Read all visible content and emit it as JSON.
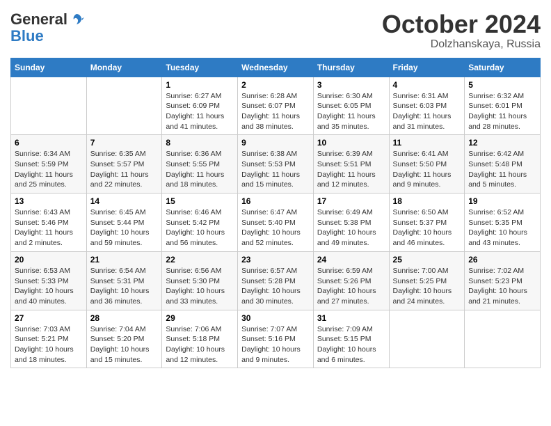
{
  "logo": {
    "general": "General",
    "blue": "Blue",
    "icon": "▶"
  },
  "title": "October 2024",
  "subtitle": "Dolzhanskaya, Russia",
  "days_of_week": [
    "Sunday",
    "Monday",
    "Tuesday",
    "Wednesday",
    "Thursday",
    "Friday",
    "Saturday"
  ],
  "weeks": [
    [
      {
        "num": "",
        "info": ""
      },
      {
        "num": "",
        "info": ""
      },
      {
        "num": "1",
        "info": "Sunrise: 6:27 AM\nSunset: 6:09 PM\nDaylight: 11 hours and 41 minutes."
      },
      {
        "num": "2",
        "info": "Sunrise: 6:28 AM\nSunset: 6:07 PM\nDaylight: 11 hours and 38 minutes."
      },
      {
        "num": "3",
        "info": "Sunrise: 6:30 AM\nSunset: 6:05 PM\nDaylight: 11 hours and 35 minutes."
      },
      {
        "num": "4",
        "info": "Sunrise: 6:31 AM\nSunset: 6:03 PM\nDaylight: 11 hours and 31 minutes."
      },
      {
        "num": "5",
        "info": "Sunrise: 6:32 AM\nSunset: 6:01 PM\nDaylight: 11 hours and 28 minutes."
      }
    ],
    [
      {
        "num": "6",
        "info": "Sunrise: 6:34 AM\nSunset: 5:59 PM\nDaylight: 11 hours and 25 minutes."
      },
      {
        "num": "7",
        "info": "Sunrise: 6:35 AM\nSunset: 5:57 PM\nDaylight: 11 hours and 22 minutes."
      },
      {
        "num": "8",
        "info": "Sunrise: 6:36 AM\nSunset: 5:55 PM\nDaylight: 11 hours and 18 minutes."
      },
      {
        "num": "9",
        "info": "Sunrise: 6:38 AM\nSunset: 5:53 PM\nDaylight: 11 hours and 15 minutes."
      },
      {
        "num": "10",
        "info": "Sunrise: 6:39 AM\nSunset: 5:51 PM\nDaylight: 11 hours and 12 minutes."
      },
      {
        "num": "11",
        "info": "Sunrise: 6:41 AM\nSunset: 5:50 PM\nDaylight: 11 hours and 9 minutes."
      },
      {
        "num": "12",
        "info": "Sunrise: 6:42 AM\nSunset: 5:48 PM\nDaylight: 11 hours and 5 minutes."
      }
    ],
    [
      {
        "num": "13",
        "info": "Sunrise: 6:43 AM\nSunset: 5:46 PM\nDaylight: 11 hours and 2 minutes."
      },
      {
        "num": "14",
        "info": "Sunrise: 6:45 AM\nSunset: 5:44 PM\nDaylight: 10 hours and 59 minutes."
      },
      {
        "num": "15",
        "info": "Sunrise: 6:46 AM\nSunset: 5:42 PM\nDaylight: 10 hours and 56 minutes."
      },
      {
        "num": "16",
        "info": "Sunrise: 6:47 AM\nSunset: 5:40 PM\nDaylight: 10 hours and 52 minutes."
      },
      {
        "num": "17",
        "info": "Sunrise: 6:49 AM\nSunset: 5:38 PM\nDaylight: 10 hours and 49 minutes."
      },
      {
        "num": "18",
        "info": "Sunrise: 6:50 AM\nSunset: 5:37 PM\nDaylight: 10 hours and 46 minutes."
      },
      {
        "num": "19",
        "info": "Sunrise: 6:52 AM\nSunset: 5:35 PM\nDaylight: 10 hours and 43 minutes."
      }
    ],
    [
      {
        "num": "20",
        "info": "Sunrise: 6:53 AM\nSunset: 5:33 PM\nDaylight: 10 hours and 40 minutes."
      },
      {
        "num": "21",
        "info": "Sunrise: 6:54 AM\nSunset: 5:31 PM\nDaylight: 10 hours and 36 minutes."
      },
      {
        "num": "22",
        "info": "Sunrise: 6:56 AM\nSunset: 5:30 PM\nDaylight: 10 hours and 33 minutes."
      },
      {
        "num": "23",
        "info": "Sunrise: 6:57 AM\nSunset: 5:28 PM\nDaylight: 10 hours and 30 minutes."
      },
      {
        "num": "24",
        "info": "Sunrise: 6:59 AM\nSunset: 5:26 PM\nDaylight: 10 hours and 27 minutes."
      },
      {
        "num": "25",
        "info": "Sunrise: 7:00 AM\nSunset: 5:25 PM\nDaylight: 10 hours and 24 minutes."
      },
      {
        "num": "26",
        "info": "Sunrise: 7:02 AM\nSunset: 5:23 PM\nDaylight: 10 hours and 21 minutes."
      }
    ],
    [
      {
        "num": "27",
        "info": "Sunrise: 7:03 AM\nSunset: 5:21 PM\nDaylight: 10 hours and 18 minutes."
      },
      {
        "num": "28",
        "info": "Sunrise: 7:04 AM\nSunset: 5:20 PM\nDaylight: 10 hours and 15 minutes."
      },
      {
        "num": "29",
        "info": "Sunrise: 7:06 AM\nSunset: 5:18 PM\nDaylight: 10 hours and 12 minutes."
      },
      {
        "num": "30",
        "info": "Sunrise: 7:07 AM\nSunset: 5:16 PM\nDaylight: 10 hours and 9 minutes."
      },
      {
        "num": "31",
        "info": "Sunrise: 7:09 AM\nSunset: 5:15 PM\nDaylight: 10 hours and 6 minutes."
      },
      {
        "num": "",
        "info": ""
      },
      {
        "num": "",
        "info": ""
      }
    ]
  ]
}
